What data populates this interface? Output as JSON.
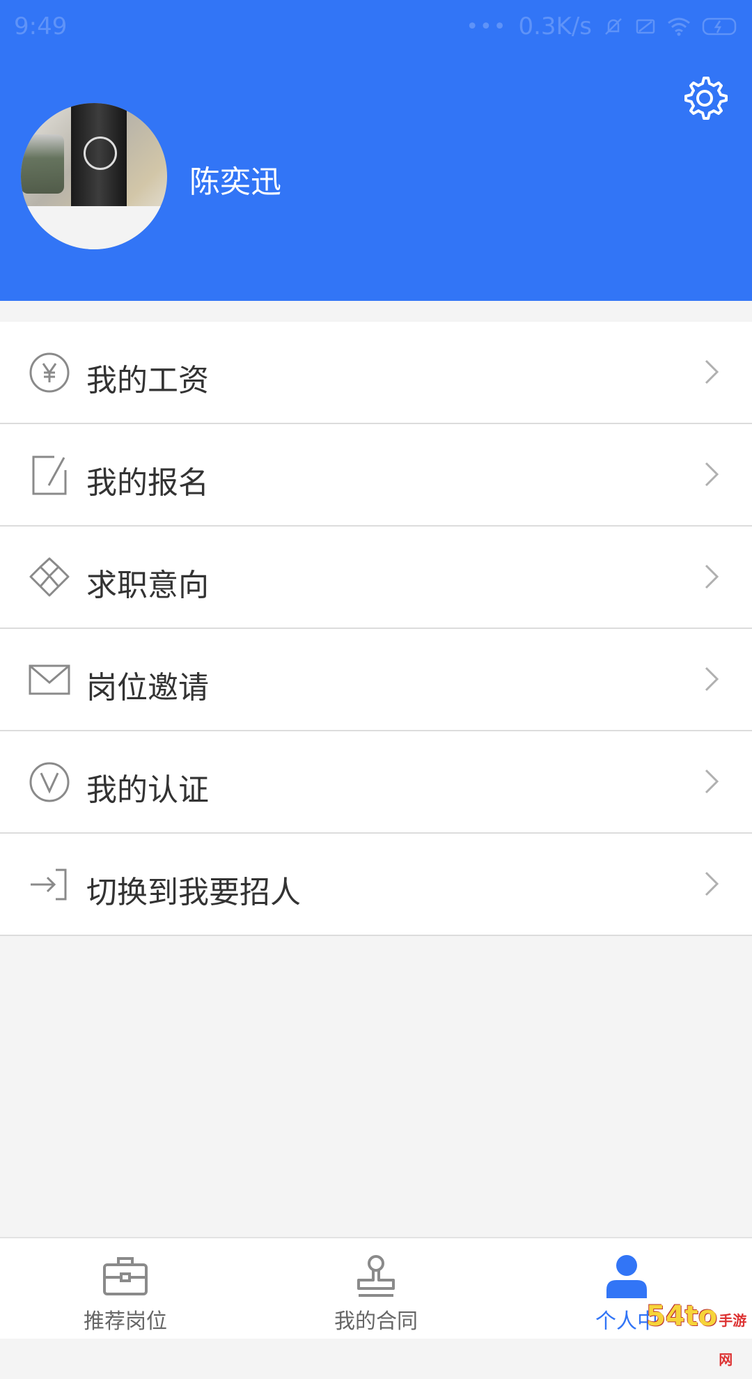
{
  "status_bar": {
    "time": "9:49",
    "network_speed": "0.3K/s",
    "icons": [
      "mute-icon",
      "sim-icon",
      "wifi-icon",
      "battery-icon"
    ]
  },
  "header": {
    "user_name": "陈奕迅",
    "settings_icon": "gear-icon",
    "background_color": "#3275f6"
  },
  "menu": {
    "items": [
      {
        "label": "我的工资",
        "icon": "yen-circle-icon"
      },
      {
        "label": "我的报名",
        "icon": "edit-document-icon"
      },
      {
        "label": "求职意向",
        "icon": "diamond-icon"
      },
      {
        "label": "岗位邀请",
        "icon": "envelope-icon"
      },
      {
        "label": "我的认证",
        "icon": "verify-v-icon"
      },
      {
        "label": "切换到我要招人",
        "icon": "switch-login-icon"
      }
    ]
  },
  "tabbar": {
    "tabs": [
      {
        "label": "推荐岗位",
        "icon": "briefcase-icon",
        "active": false
      },
      {
        "label": "我的合同",
        "icon": "stamp-icon",
        "active": false
      },
      {
        "label": "个人中",
        "icon": "person-icon",
        "active": true
      }
    ],
    "active_color": "#3275f6"
  },
  "watermark": {
    "text": "54to",
    "sub": "手游网"
  }
}
